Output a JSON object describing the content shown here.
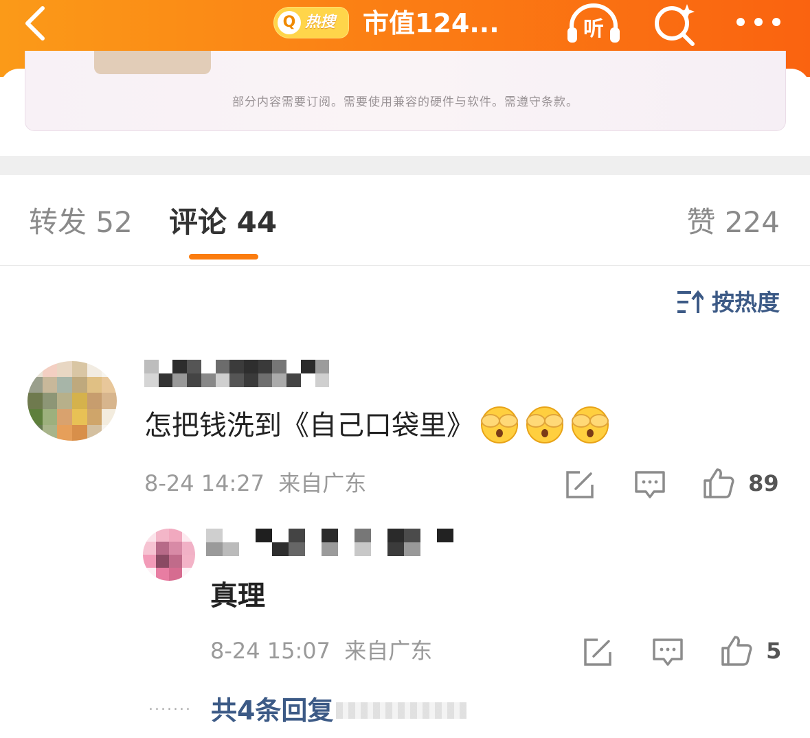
{
  "topbar": {
    "badge_label": "热搜",
    "title": "市值124...",
    "listen_label": "听"
  },
  "ad": {
    "disclaimer": "部分内容需要订阅。需要使用兼容的硬件与软件。需遵守条款。"
  },
  "tabs": [
    {
      "label": "转发 52"
    },
    {
      "label": "评论 44"
    },
    {
      "label": "赞 224"
    }
  ],
  "sort": {
    "label": "按热度"
  },
  "comment": {
    "text": "怎把钱洗到《自己口袋里》",
    "emoji": [
      "see-no-evil-icon",
      "see-no-evil-icon",
      "see-no-evil-icon"
    ],
    "time": "8-24 14:27",
    "location": "来自广东",
    "likes": "89"
  },
  "reply": {
    "text": "真理",
    "time": "8-24 15:07",
    "location": "来自广东",
    "likes": "5"
  },
  "more_replies": {
    "label": "共4条回复"
  },
  "colors": {
    "brand_orange": "#fb7c0f",
    "link_blue": "#3c5a86"
  }
}
